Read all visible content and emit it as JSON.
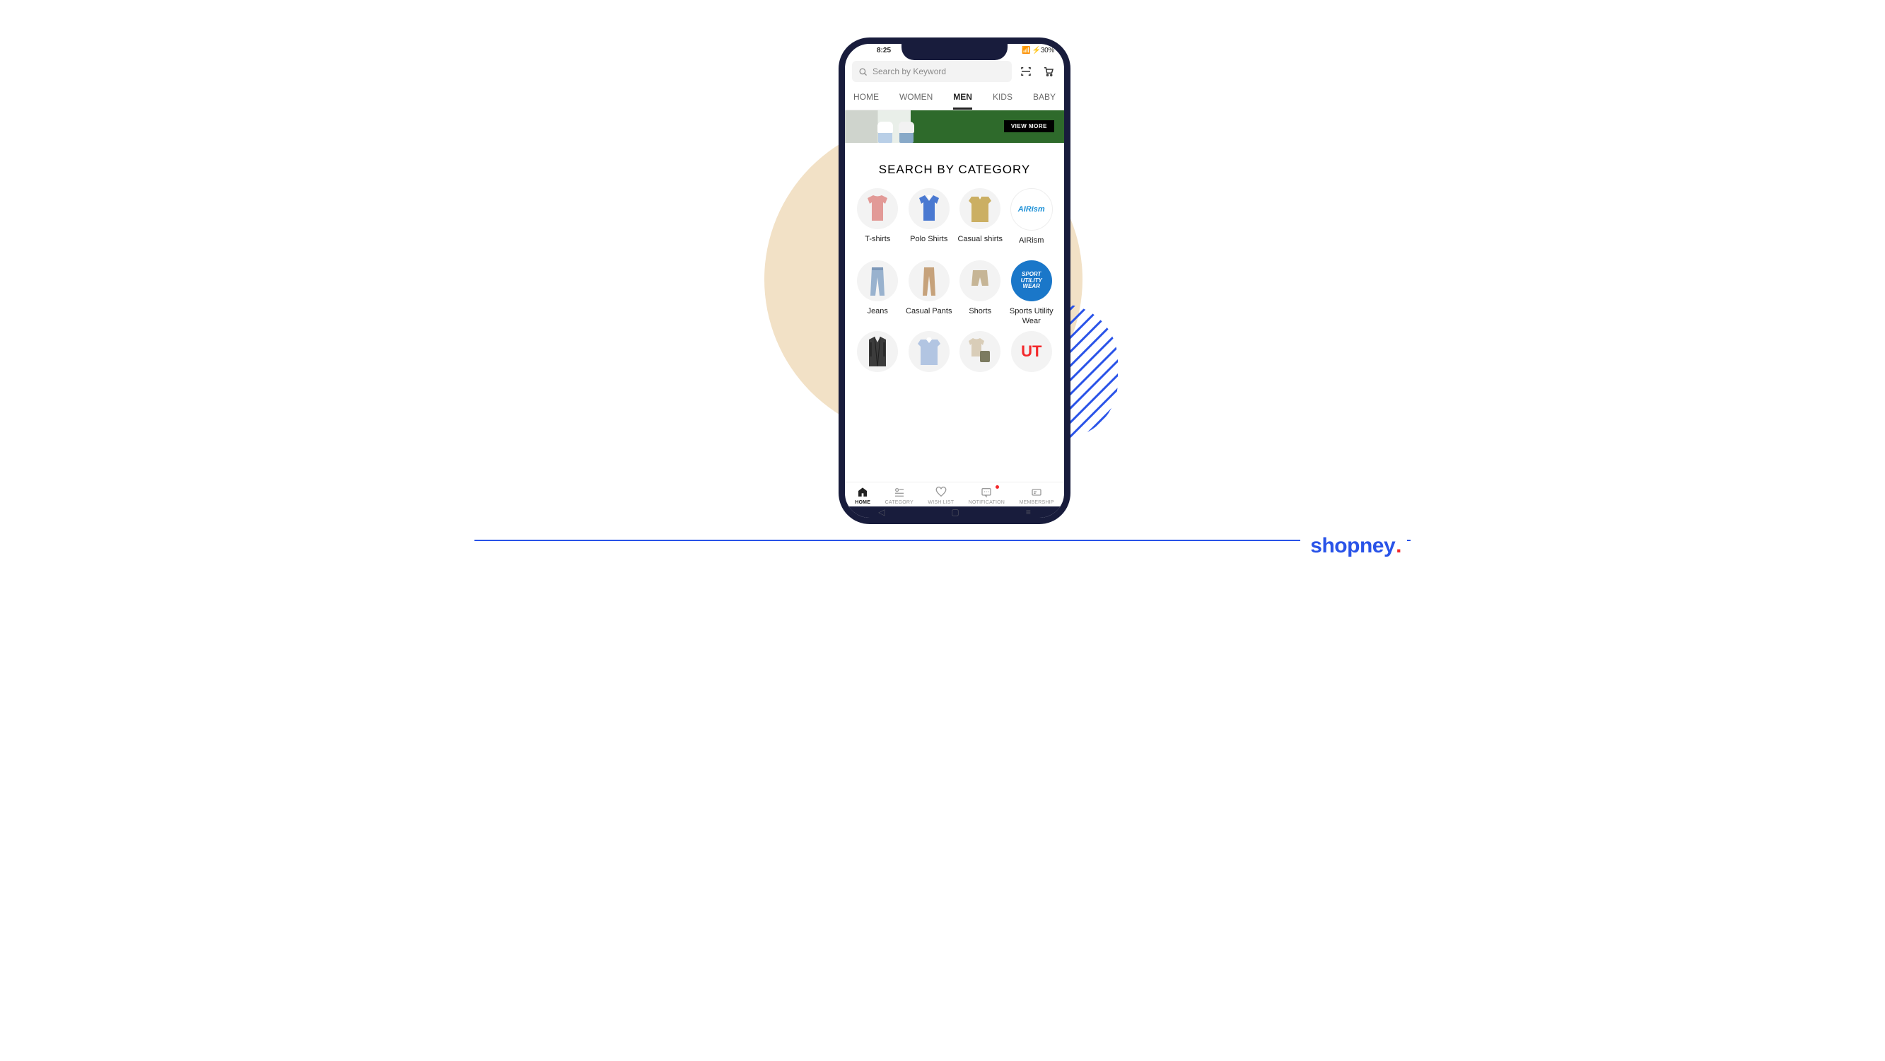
{
  "status": {
    "time": "8:25",
    "right": "📶 ⚡30%"
  },
  "search": {
    "placeholder": "Search by Keyword"
  },
  "tabs": {
    "items": [
      {
        "label": "HOME"
      },
      {
        "label": "WOMEN"
      },
      {
        "label": "MEN",
        "active": true
      },
      {
        "label": "KIDS"
      },
      {
        "label": "BABY"
      }
    ]
  },
  "banner": {
    "cta": "VIEW MORE"
  },
  "section_title": "SEARCH BY CATEGORY",
  "categories": [
    {
      "label": "T-shirts",
      "kind": "tshirt",
      "color": "#E29A97"
    },
    {
      "label": "Polo Shirts",
      "kind": "polo",
      "color": "#4A79D1"
    },
    {
      "label": "Casual shirts",
      "kind": "cshirt",
      "color": "#CBAF63"
    },
    {
      "label": "AIRism",
      "kind": "brand-airism",
      "text": "AIRism"
    },
    {
      "label": "Jeans",
      "kind": "jeans",
      "color": "#99B2CE"
    },
    {
      "label": "Casual Pants",
      "kind": "pants",
      "color": "#C6A27B"
    },
    {
      "label": "Shorts",
      "kind": "shorts",
      "color": "#C6B596"
    },
    {
      "label": "Sports Utility Wear",
      "kind": "brand-suw",
      "text": "SPORT\nUTILITY\nWEAR"
    },
    {
      "label": "",
      "kind": "jacket",
      "color": "#3C3C3C"
    },
    {
      "label": "",
      "kind": "dress-shirt",
      "color": "#B2C5E2"
    },
    {
      "label": "",
      "kind": "set",
      "color": "#D9CDB8",
      "color2": "#7C7B60"
    },
    {
      "label": "",
      "kind": "brand-ut",
      "text": "UT"
    }
  ],
  "bottomnav": [
    {
      "label": "HOME",
      "icon": "home",
      "active": true
    },
    {
      "label": "CATEGORY",
      "icon": "category"
    },
    {
      "label": "WISH LIST",
      "icon": "wishlist"
    },
    {
      "label": "NOTIFICATION",
      "icon": "notification",
      "badge": true
    },
    {
      "label": "MEMBERSHIP",
      "icon": "membership"
    }
  ],
  "brand": "shopney"
}
